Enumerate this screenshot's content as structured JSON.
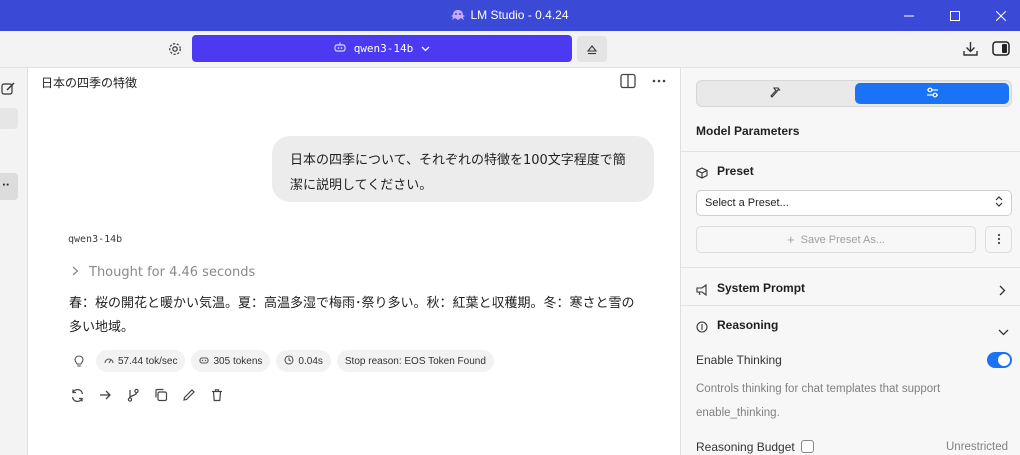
{
  "window": {
    "app_name": "LM Studio",
    "version": "0.4.24",
    "title_separator": " - ",
    "accent_color": "#3a49d6"
  },
  "toolbar": {
    "model_name": "qwen3-14b",
    "model_button_color": "#4b3af2"
  },
  "chat": {
    "title": "日本の四季の特徴",
    "user_message": "日本の四季について、それぞれの特徴を100文字程度で簡潔に説明してください。",
    "assistant_name": "qwen3-14b",
    "thought_label": "Thought for 4.46 seconds",
    "answer": "春：桜の開花と暖かい気温。夏：高温多湿で梅雨･祭り多い。秋：紅葉と収穫期。冬：寒さと雪の多い地域。",
    "stats": {
      "speed": "57.44 tok/sec",
      "tokens": "305 tokens",
      "time": "0.04s",
      "stop_reason": "Stop reason: EOS Token Found"
    }
  },
  "right_panel": {
    "header": "Model Parameters",
    "preset": {
      "label": "Preset",
      "select_placeholder": "Select a Preset...",
      "save_label": "Save Preset As..."
    },
    "system_prompt_label": "System Prompt",
    "reasoning": {
      "label": "Reasoning",
      "enable_thinking_label": "Enable Thinking",
      "enable_thinking_on": true,
      "description_line1": "Controls thinking for chat templates that support",
      "description_line2": "enable_thinking.",
      "budget_label": "Reasoning Budget",
      "budget_value": "Unrestricted"
    },
    "toggle_color": "#1a73f5"
  }
}
